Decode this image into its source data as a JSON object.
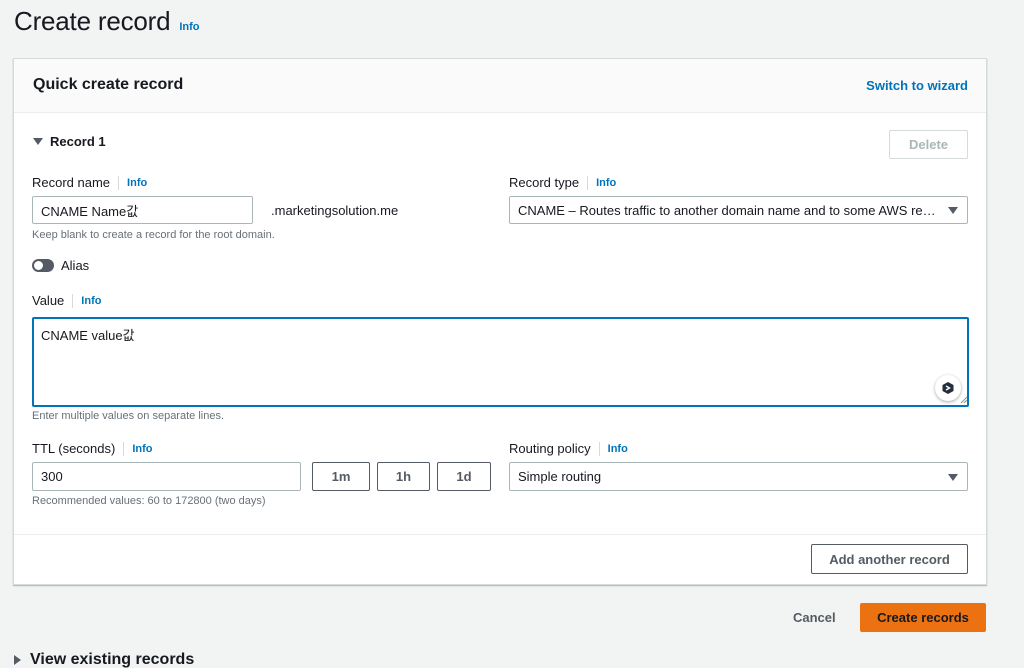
{
  "page": {
    "title": "Create record",
    "info": "Info"
  },
  "panel": {
    "title": "Quick create record",
    "switch_link": "Switch to wizard"
  },
  "record": {
    "label": "Record 1",
    "delete_label": "Delete",
    "name": {
      "label": "Record name",
      "info": "Info",
      "value": "CNAME Name값",
      "domain_suffix": ".marketingsolution.me",
      "hint": "Keep blank to create a record for the root domain."
    },
    "type": {
      "label": "Record type",
      "info": "Info",
      "selected": "CNAME – Routes traffic to another domain name and to some AWS resources"
    },
    "alias": {
      "label": "Alias",
      "enabled": false
    },
    "value": {
      "label": "Value",
      "info": "Info",
      "text": "CNAME value값",
      "hint": "Enter multiple values on separate lines."
    },
    "ttl": {
      "label": "TTL (seconds)",
      "info": "Info",
      "value": "300",
      "presets": [
        "1m",
        "1h",
        "1d"
      ],
      "hint": "Recommended values: 60 to 172800 (two days)"
    },
    "routing": {
      "label": "Routing policy",
      "info": "Info",
      "selected": "Simple routing"
    }
  },
  "add_another_label": "Add another record",
  "footer": {
    "cancel_label": "Cancel",
    "create_label": "Create records"
  },
  "view_existing_label": "View existing records",
  "colors": {
    "primary": "#ec7211",
    "link": "#0073bb",
    "focus": "#0073bb"
  },
  "icons": [
    "caret-down-icon",
    "caret-right-icon",
    "dropdown-triangle-icon",
    "assistant-icon",
    "resize-grip-icon"
  ]
}
